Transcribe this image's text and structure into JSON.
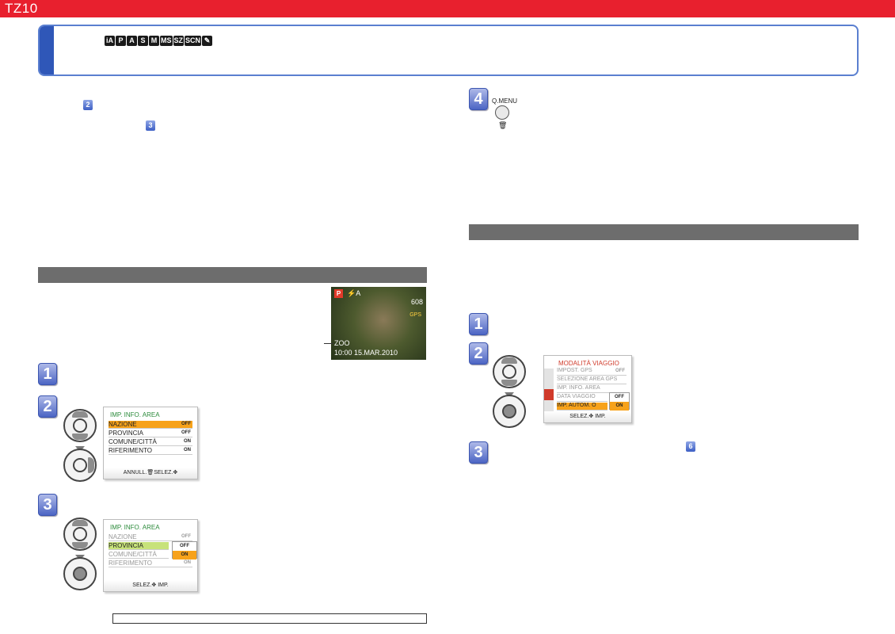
{
  "header": {
    "model": "TZ10"
  },
  "mode_icons": [
    "iA",
    "P",
    "A",
    "S",
    "M",
    "MS",
    "SZ",
    "SCN",
    "✎"
  ],
  "ref_badges": [
    "2",
    "3",
    "6"
  ],
  "steps": [
    "1",
    "2",
    "3",
    "4",
    "1",
    "2",
    "3"
  ],
  "photo": {
    "area_label": "ZOO",
    "datetime": "10:00  15.MAR.2010",
    "shots": "608",
    "mode": "P",
    "gps": "GPS"
  },
  "qmenu": {
    "label": "Q.MENU",
    "icon": "trash-icon"
  },
  "screen_info_area_1": {
    "title": "IMP. INFO. AREA",
    "rows": [
      {
        "label": "NAZIONE",
        "value": "OFF"
      },
      {
        "label": "PROVINCIA",
        "value": "OFF"
      },
      {
        "label": "COMUNE/CITTÀ",
        "value": "ON"
      },
      {
        "label": "RIFERIMENTO",
        "value": "ON"
      }
    ],
    "footer": "ANNULL.🗑SELEZ.✥"
  },
  "screen_info_area_2": {
    "title": "IMP. INFO. AREA",
    "rows": [
      {
        "label": "NAZIONE",
        "value": "OFF"
      },
      {
        "label": "PROVINCIA",
        "value": ""
      },
      {
        "label": "COMUNE/CITTÀ",
        "value": "ON"
      },
      {
        "label": "RIFERIMENTO",
        "value": "ON"
      }
    ],
    "popup": [
      "OFF",
      "ON"
    ],
    "footer": "SELEZ.✥ IMP."
  },
  "screen_travel": {
    "title": "MODALITÀ VIAGGIO",
    "rows": [
      {
        "label": "IMPOST. GPS",
        "value": "OFF"
      },
      {
        "label": "SELEZIONE AREA GPS",
        "value": ""
      },
      {
        "label": "IMP. INFO. AREA",
        "value": ""
      },
      {
        "label": "DATA VIAGGIO",
        "value": ""
      },
      {
        "label": "IMP. AUTOM. O",
        "value": ""
      }
    ],
    "popup": [
      "OFF",
      "ON"
    ],
    "footer": "SELEZ.✥ IMP."
  },
  "colors": {
    "brand_red": "#e8202e",
    "accent_blue": "#2f57b8",
    "highlight_orange": "#f7a21a"
  }
}
